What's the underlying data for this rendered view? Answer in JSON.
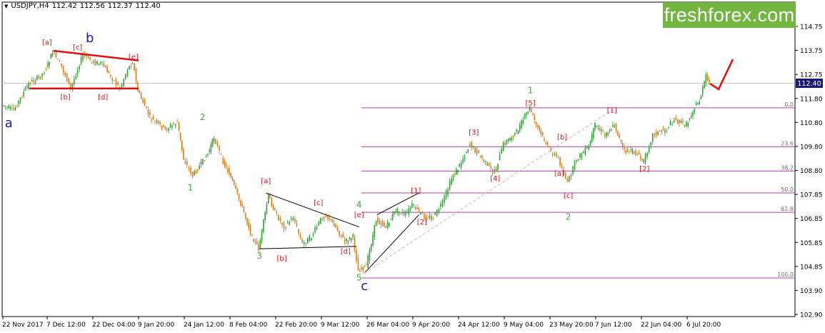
{
  "header": {
    "triangle_icon": "triangle-down-icon",
    "symbol": "USDJPY,H4",
    "open": "112.42",
    "high": "112.56",
    "low": "112.37",
    "close": "112.40"
  },
  "brand": {
    "text": "freshforex.com",
    "color": "#72b53f"
  },
  "colors": {
    "bull": "#2aa534",
    "bear": "#e07a17",
    "fib": "#b040b0",
    "wave_red": "#e01010",
    "wave_green": "#3fae3f",
    "wave_blue": "#1a1ab0",
    "current_price": "#1a1a6e"
  },
  "chart_data": {
    "type": "line",
    "instrument": "USDJPY",
    "timeframe": "H4",
    "x_tick_labels": [
      "22 Nov 2017",
      "7 Dec 12:00",
      "22 Dec 04:00",
      "9 Jan 20:00",
      "24 Jan 12:00",
      "8 Feb 04:00",
      "22 Feb 20:00",
      "9 Mar 12:00",
      "26 Mar 04:00",
      "9 Apr 20:00",
      "24 Apr 12:00",
      "9 May 04:00",
      "23 May 20:00",
      "7 Jun 12:00",
      "22 Jun 04:00",
      "6 Jul 20:00"
    ],
    "y_tick_labels": [
      "114.75",
      "113.75",
      "112.75",
      "111.80",
      "110.80",
      "109.80",
      "108.80",
      "107.85",
      "106.85",
      "105.85",
      "104.85",
      "103.90",
      "102.90"
    ],
    "ylim": [
      102.9,
      115.2
    ],
    "current_price": "112.40",
    "price_path": [
      [
        "22 Nov 2017",
        111.5
      ],
      [
        "26 Nov",
        111.3
      ],
      [
        "1 Dec",
        112.4
      ],
      [
        "5 Dec",
        112.7
      ],
      [
        "7 Dec 12:00",
        113.0
      ],
      [
        "9 Dec",
        113.7
      ],
      [
        "12 Dec",
        113.1
      ],
      [
        "15 Dec",
        112.2
      ],
      [
        "19 Dec",
        113.6
      ],
      [
        "22 Dec 04:00",
        113.3
      ],
      [
        "26 Dec",
        113.2
      ],
      [
        "30 Dec",
        112.6
      ],
      [
        "2 Jan",
        112.2
      ],
      [
        "5 Jan",
        113.0
      ],
      [
        "7 Jan",
        113.3
      ],
      [
        "9 Jan 20:00",
        112.1
      ],
      [
        "13 Jan",
        111.0
      ],
      [
        "18 Jan",
        110.5
      ],
      [
        "22 Jan",
        110.8
      ],
      [
        "24 Jan 12:00",
        109.3
      ],
      [
        "27 Jan",
        108.6
      ],
      [
        "1 Feb",
        109.5
      ],
      [
        "3 Feb",
        110.2
      ],
      [
        "6 Feb",
        109.2
      ],
      [
        "8 Feb 04:00",
        108.7
      ],
      [
        "12 Feb",
        107.3
      ],
      [
        "15 Feb",
        106.1
      ],
      [
        "17 Feb",
        105.6
      ],
      [
        "20 Feb",
        107.8
      ],
      [
        "22 Feb 20:00",
        107.1
      ],
      [
        "25 Feb",
        106.5
      ],
      [
        "28 Feb",
        106.9
      ],
      [
        "3 Mar",
        105.8
      ],
      [
        "6 Mar",
        106.1
      ],
      [
        "9 Mar 12:00",
        106.8
      ],
      [
        "11 Mar",
        107.0
      ],
      [
        "14 Mar",
        106.6
      ],
      [
        "18 Mar",
        105.9
      ],
      [
        "21 Mar",
        106.1
      ],
      [
        "23 Mar",
        104.7
      ],
      [
        "26 Mar 04:00",
        104.9
      ],
      [
        "29 Mar",
        106.8
      ],
      [
        "1 Apr",
        106.5
      ],
      [
        "4 Apr",
        107.2
      ],
      [
        "7 Apr",
        107.0
      ],
      [
        "9 Apr 20:00",
        107.4
      ],
      [
        "13 Apr",
        106.9
      ],
      [
        "16 Apr",
        106.9
      ],
      [
        "19 Apr",
        107.5
      ],
      [
        "22 Apr",
        108.5
      ],
      [
        "24 Apr 12:00",
        108.9
      ],
      [
        "28 Apr",
        109.9
      ],
      [
        "2 May",
        109.3
      ],
      [
        "6 May",
        108.7
      ],
      [
        "9 May 04:00",
        109.9
      ],
      [
        "13 May",
        110.4
      ],
      [
        "17 May",
        111.4
      ],
      [
        "19 May",
        110.7
      ],
      [
        "23 May 20:00",
        109.7
      ],
      [
        "26 May",
        109.3
      ],
      [
        "29 May",
        108.3
      ],
      [
        "1 Jun",
        109.3
      ],
      [
        "5 Jun",
        109.8
      ],
      [
        "7 Jun 12:00",
        110.7
      ],
      [
        "10 Jun",
        110.3
      ],
      [
        "13 Jun",
        110.7
      ],
      [
        "16 Jun",
        109.6
      ],
      [
        "19 Jun",
        109.6
      ],
      [
        "22 Jun 04:00",
        109.2
      ],
      [
        "25 Jun",
        110.3
      ],
      [
        "29 Jun",
        110.5
      ],
      [
        "2 Jul",
        110.9
      ],
      [
        "6 Jul 20:00",
        110.7
      ],
      [
        "8 Jul",
        111.3
      ],
      [
        "10 Jul",
        111.7
      ],
      [
        "12 Jul",
        112.7
      ],
      [
        "13 Jul",
        112.4
      ]
    ],
    "fibonacci": {
      "levels": [
        {
          "label": "0.0",
          "price": 111.4
        },
        {
          "label": "23.6",
          "price": 109.8
        },
        {
          "label": "38.2",
          "price": 108.8
        },
        {
          "label": "50.0",
          "price": 107.9
        },
        {
          "label": "61.8",
          "price": 107.1
        },
        {
          "label": "100.0",
          "price": 104.4
        }
      ]
    },
    "wave_labels": [
      {
        "text": "a",
        "time": "24 Nov",
        "price": 110.6,
        "color": "blue"
      },
      {
        "text": "b",
        "time": "21 Dec",
        "price": 114.1,
        "color": "blue"
      },
      {
        "text": "c",
        "time": "25 Mar",
        "price": 103.9,
        "color": "blue"
      },
      {
        "text": "[a]",
        "time": "7 Dec",
        "price": 114.0,
        "color": "red"
      },
      {
        "text": "[b]",
        "time": "13 Dec",
        "price": 111.75,
        "color": "red"
      },
      {
        "text": "[c]",
        "time": "17 Dec",
        "price": 113.8,
        "color": "red"
      },
      {
        "text": "[d]",
        "time": "26 Dec",
        "price": 111.75,
        "color": "red"
      },
      {
        "text": "[e]",
        "time": "7 Jan",
        "price": 113.4,
        "color": "red"
      },
      {
        "text": "2",
        "time": "30 Jan",
        "price": 110.9,
        "color": "green"
      },
      {
        "text": "1",
        "time": "26 Jan",
        "price": 108.0,
        "color": "green"
      },
      {
        "text": "3",
        "time": "17 Feb",
        "price": 105.2,
        "color": "green"
      },
      {
        "text": "[a]",
        "time": "19 Feb",
        "price": 108.3,
        "color": "red"
      },
      {
        "text": "[b]",
        "time": "24 Feb",
        "price": 105.1,
        "color": "red"
      },
      {
        "text": "[c]",
        "time": "8 Mar",
        "price": 107.4,
        "color": "red"
      },
      {
        "text": "[d]",
        "time": "18 Mar",
        "price": 105.4,
        "color": "red"
      },
      {
        "text": "[e]",
        "time": "23 Mar",
        "price": 106.9,
        "color": "red"
      },
      {
        "text": "4",
        "time": "23 Mar",
        "price": 107.3,
        "color": "green"
      },
      {
        "text": "5",
        "time": "23 Mar",
        "price": 104.3,
        "color": "green"
      },
      {
        "text": "[1]",
        "time": "10 Apr",
        "price": 107.9,
        "color": "red"
      },
      {
        "text": "[2]",
        "time": "12 Apr",
        "price": 106.6,
        "color": "red"
      },
      {
        "text": "[3]",
        "time": "29 Apr",
        "price": 110.3,
        "color": "red"
      },
      {
        "text": "[4]",
        "time": "6 May",
        "price": 108.4,
        "color": "red"
      },
      {
        "text": "[5]",
        "time": "17 May",
        "price": 111.5,
        "color": "red"
      },
      {
        "text": "1",
        "time": "17 May",
        "price": 112.0,
        "color": "green"
      },
      {
        "text": "[a]",
        "time": "26 May",
        "price": 108.6,
        "color": "red"
      },
      {
        "text": "[b]",
        "time": "27 May",
        "price": 110.1,
        "color": "red"
      },
      {
        "text": "[c]",
        "time": "29 May",
        "price": 107.7,
        "color": "red"
      },
      {
        "text": "2",
        "time": "29 May",
        "price": 106.8,
        "color": "green"
      },
      {
        "text": "[1]",
        "time": "12 Jun",
        "price": 111.2,
        "color": "red"
      },
      {
        "text": "[2]",
        "time": "22 Jun",
        "price": 108.8,
        "color": "red"
      }
    ],
    "trendlines": [
      {
        "name": "b-triangle-top",
        "color": "red",
        "from": [
          "9 Dec",
          113.75
        ],
        "to": [
          "9 Jan",
          113.35
        ]
      },
      {
        "name": "b-triangle-bottom",
        "color": "red",
        "from": [
          "1 Dec",
          112.2
        ],
        "to": [
          "9 Jan",
          112.2
        ]
      },
      {
        "name": "4-triangle-top",
        "color": "black",
        "from": [
          "19 Feb",
          107.9
        ],
        "to": [
          "23 Mar",
          106.5
        ]
      },
      {
        "name": "4-triangle-bottom",
        "color": "black",
        "from": [
          "17 Feb",
          105.6
        ],
        "to": [
          "22 Mar",
          105.7
        ]
      },
      {
        "name": "diagonal-top",
        "color": "black",
        "from": [
          "29 Mar",
          107.0
        ],
        "to": [
          "11 Apr",
          107.9
        ]
      },
      {
        "name": "diagonal-bottom",
        "color": "black",
        "from": [
          "25 Mar",
          104.6
        ],
        "to": [
          "11 Apr",
          107.0
        ]
      },
      {
        "name": "support-dashed",
        "color": "pink",
        "from": [
          "25 Mar",
          104.6
        ],
        "to": [
          "13 Jun",
          111.4
        ]
      },
      {
        "name": "projection",
        "color": "red",
        "from": [
          "13 Jul",
          112.4
        ],
        "to": [
          "20 Jul",
          113.4
        ]
      }
    ]
  }
}
